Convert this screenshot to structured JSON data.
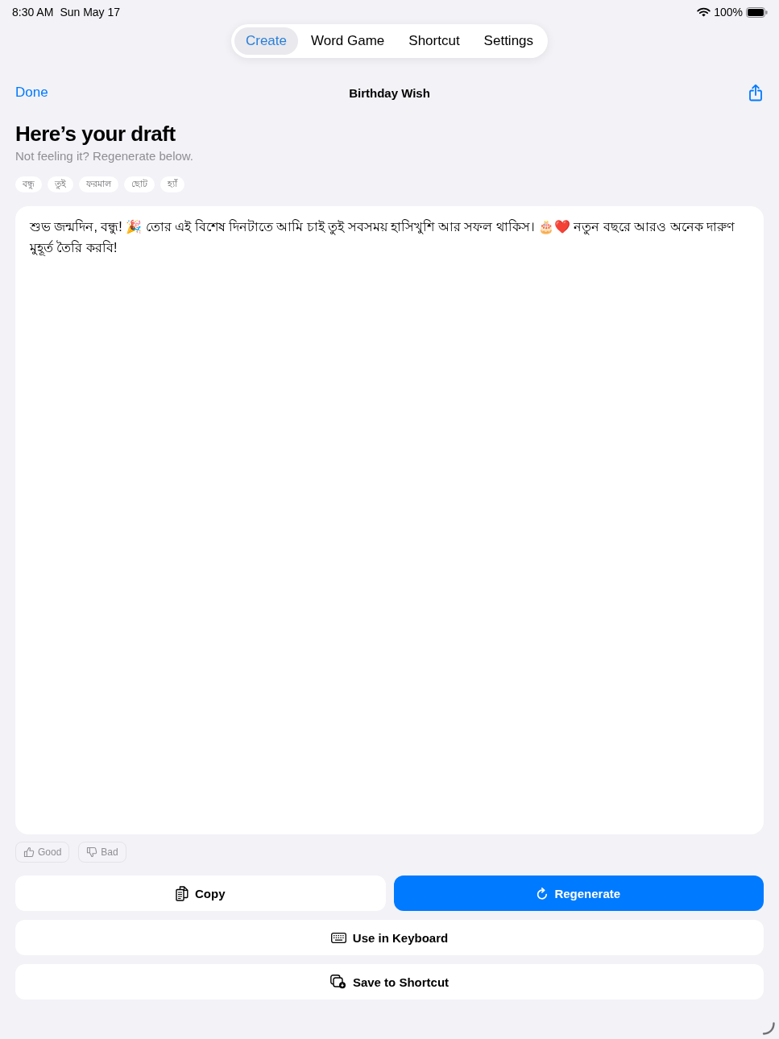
{
  "status_bar": {
    "time": "8:30 AM",
    "date": "Sun May 17",
    "battery": "100%"
  },
  "tabs": [
    {
      "label": "Create",
      "selected": true
    },
    {
      "label": "Word Game",
      "selected": false
    },
    {
      "label": "Shortcut",
      "selected": false
    },
    {
      "label": "Settings",
      "selected": false
    }
  ],
  "nav": {
    "done": "Done",
    "title": "Birthday Wish"
  },
  "header": {
    "title": "Here’s your draft",
    "subtitle": "Not feeling it? Regenerate below."
  },
  "tags": [
    "বন্ধু",
    "তুই",
    "ফরমাল",
    "ছোট",
    "হ্যাঁ"
  ],
  "draft": {
    "text": "শুভ জন্মদিন, বন্ধু! 🎉 তোর এই বিশেষ দিনটাতে আমি চাই তুই সবসময় হাসিখুশি আর সফল থাকিস। 🎂❤️ নতুন বছরে আরও অনেক দারুণ মুহূর্ত তৈরি করবি!"
  },
  "feedback": [
    {
      "kind": "up",
      "label": "Good",
      "selected": false
    },
    {
      "kind": "down",
      "label": "Bad",
      "selected": false
    }
  ],
  "action_rows": [
    {
      "buttons": [
        {
          "kind": "copy",
          "label": "Copy",
          "primary": false
        },
        {
          "kind": "regenerate",
          "label": "Regenerate",
          "primary": true
        }
      ]
    },
    {
      "buttons": [
        {
          "kind": "keyboard",
          "label": "Use in Keyboard",
          "primary": false
        }
      ]
    },
    {
      "buttons": [
        {
          "kind": "shortcut",
          "label": "Save to Shortcut",
          "primary": false
        }
      ]
    }
  ]
}
